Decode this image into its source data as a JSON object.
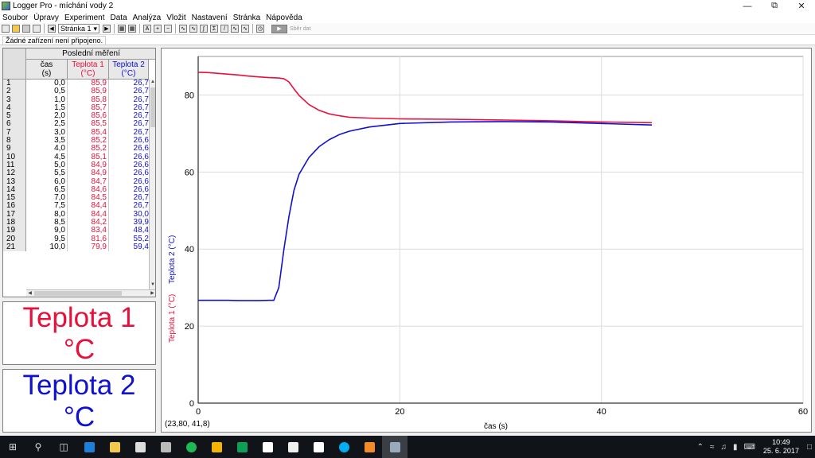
{
  "window": {
    "title": "Logger Pro - míchání vody 2"
  },
  "menu": [
    "Soubor",
    "Úpravy",
    "Experiment",
    "Data",
    "Analýza",
    "Vložit",
    "Nastavení",
    "Stránka",
    "Nápověda"
  ],
  "toolbar": {
    "page": "Stránka 1",
    "collect_label": "Sběr dat"
  },
  "status": {
    "text": "Žádné zařízení není připojeno."
  },
  "table": {
    "title": "Poslední měření",
    "columns": [
      {
        "name": "čas",
        "unit": "(s)"
      },
      {
        "name": "Teplota 1",
        "unit": "(°C)"
      },
      {
        "name": "Teplota 2",
        "unit": "(°C)"
      }
    ],
    "rows": [
      [
        "1",
        "0,0",
        "85,9",
        "26,7"
      ],
      [
        "2",
        "0,5",
        "85,9",
        "26,7"
      ],
      [
        "3",
        "1,0",
        "85,8",
        "26,7"
      ],
      [
        "4",
        "1,5",
        "85,7",
        "26,7"
      ],
      [
        "5",
        "2,0",
        "85,6",
        "26,7"
      ],
      [
        "6",
        "2,5",
        "85,5",
        "26,7"
      ],
      [
        "7",
        "3,0",
        "85,4",
        "26,7"
      ],
      [
        "8",
        "3,5",
        "85,2",
        "26,6"
      ],
      [
        "9",
        "4,0",
        "85,2",
        "26,6"
      ],
      [
        "10",
        "4,5",
        "85,1",
        "26,6"
      ],
      [
        "11",
        "5,0",
        "84,9",
        "26,6"
      ],
      [
        "12",
        "5,5",
        "84,9",
        "26,6"
      ],
      [
        "13",
        "6,0",
        "84,7",
        "26,6"
      ],
      [
        "14",
        "6,5",
        "84,6",
        "26,6"
      ],
      [
        "15",
        "7,0",
        "84,5",
        "26,7"
      ],
      [
        "16",
        "7,5",
        "84,4",
        "26,7"
      ],
      [
        "17",
        "8,0",
        "84,4",
        "30,0"
      ],
      [
        "18",
        "8,5",
        "84,2",
        "39,9"
      ],
      [
        "19",
        "9,0",
        "83,4",
        "48,4"
      ],
      [
        "20",
        "9,5",
        "81,6",
        "55,2"
      ],
      [
        "21",
        "10,0",
        "79,9",
        "59,4"
      ]
    ]
  },
  "meters": [
    {
      "name": "Teplota 1",
      "unit": "°C",
      "color": "#e8103a"
    },
    {
      "name": "Teplota 2",
      "unit": "°C",
      "color": "#1010d0"
    }
  ],
  "graph": {
    "coord_readout": "(23,80, 41,8)"
  },
  "chart_data": {
    "type": "line",
    "xlabel": "čas (s)",
    "ylabel_series": [
      "Teplota 1 (°C)",
      "Teplota 2 (°C)"
    ],
    "xlim": [
      0,
      60
    ],
    "ylim": [
      0,
      90
    ],
    "x_ticks": [
      0,
      20,
      40,
      60
    ],
    "y_ticks": [
      0,
      20,
      40,
      60,
      80
    ],
    "grid": true,
    "series": [
      {
        "name": "Teplota 1",
        "color": "#e8103a",
        "x": [
          0,
          1,
          2,
          3,
          4,
          5,
          6,
          7,
          8,
          8.5,
          9,
          9.5,
          10,
          11,
          12,
          13,
          14,
          15,
          17,
          20,
          25,
          30,
          35,
          40,
          45
        ],
        "y": [
          85.9,
          85.8,
          85.6,
          85.4,
          85.2,
          84.9,
          84.7,
          84.5,
          84.4,
          84.2,
          83.4,
          81.6,
          79.9,
          77.5,
          76.0,
          75.1,
          74.6,
          74.2,
          74.0,
          73.8,
          73.7,
          73.5,
          73.3,
          73.0,
          72.8
        ]
      },
      {
        "name": "Teplota 2",
        "color": "#1010d0",
        "x": [
          0,
          1,
          2,
          3,
          4,
          5,
          6,
          7,
          7.5,
          8,
          8.5,
          9,
          9.5,
          10,
          11,
          12,
          13,
          14,
          15,
          17,
          20,
          25,
          30,
          35,
          40,
          45
        ],
        "y": [
          26.7,
          26.7,
          26.7,
          26.7,
          26.6,
          26.6,
          26.6,
          26.7,
          26.7,
          30.0,
          39.9,
          48.4,
          55.2,
          59.4,
          63.8,
          66.6,
          68.4,
          69.7,
          70.6,
          71.7,
          72.6,
          73.0,
          73.1,
          73.0,
          72.6,
          72.2
        ]
      }
    ]
  },
  "clock": {
    "time": "10:49",
    "date": "25. 6. 2017"
  }
}
